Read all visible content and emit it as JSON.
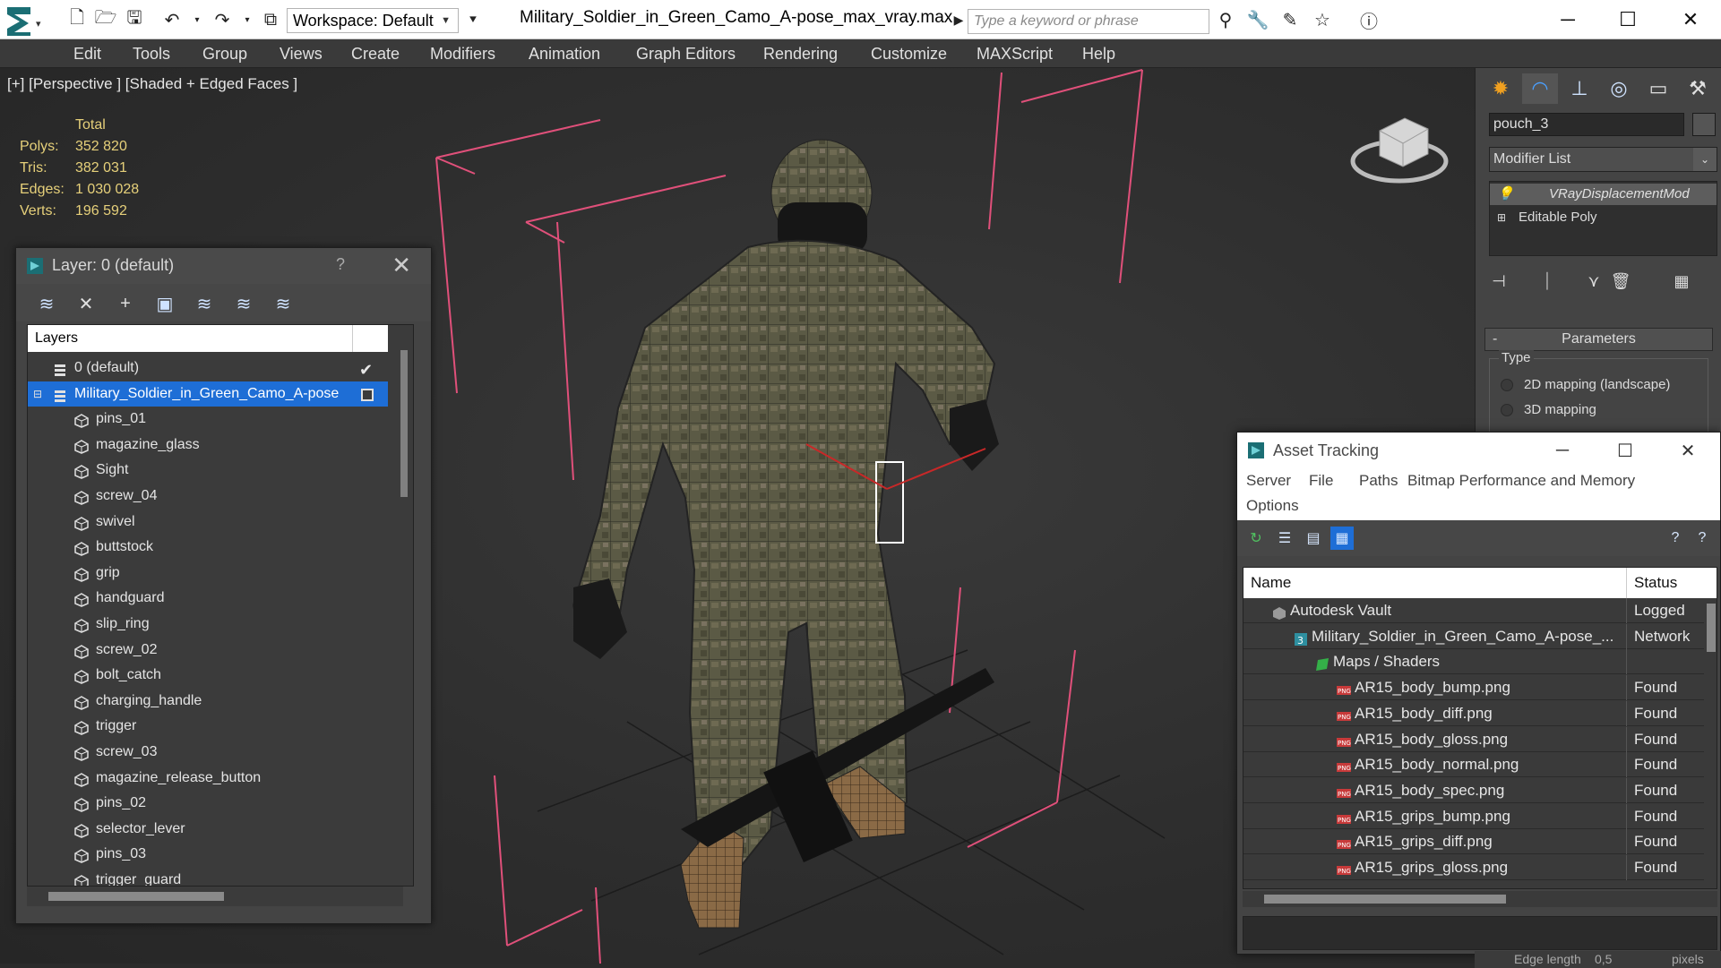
{
  "titlebar": {
    "workspace": "Workspace: Default",
    "file_title": "Military_Soldier_in_Green_Camo_A-pose_max_vray.max",
    "search_placeholder": "Type a keyword or phrase"
  },
  "menu": [
    "Edit",
    "Tools",
    "Group",
    "Views",
    "Create",
    "Modifiers",
    "Animation",
    "Graph Editors",
    "Rendering",
    "Customize",
    "MAXScript",
    "Help"
  ],
  "viewport": {
    "label": "[+] [Perspective ] [Shaded + Edged Faces ]",
    "stats": {
      "header": "Total",
      "rows": [
        {
          "k": "Polys:",
          "v": "352 820"
        },
        {
          "k": "Tris:",
          "v": "382 031"
        },
        {
          "k": "Edges:",
          "v": "1 030 028"
        },
        {
          "k": "Verts:",
          "v": "196 592"
        }
      ]
    }
  },
  "layer_dialog": {
    "title": "Layer: 0 (default)",
    "help": "?",
    "list_header": "Layers",
    "rows": [
      {
        "label": "0 (default)",
        "kind": "layer"
      },
      {
        "label": "Military_Soldier_in_Green_Camo_A-pose",
        "kind": "layer-selected"
      },
      {
        "label": "pins_01",
        "kind": "object"
      },
      {
        "label": "magazine_glass",
        "kind": "object"
      },
      {
        "label": "Sight",
        "kind": "object"
      },
      {
        "label": "screw_04",
        "kind": "object"
      },
      {
        "label": "swivel",
        "kind": "object"
      },
      {
        "label": "buttstock",
        "kind": "object"
      },
      {
        "label": "grip",
        "kind": "object"
      },
      {
        "label": "handguard",
        "kind": "object"
      },
      {
        "label": "slip_ring",
        "kind": "object"
      },
      {
        "label": "screw_02",
        "kind": "object"
      },
      {
        "label": "bolt_catch",
        "kind": "object"
      },
      {
        "label": "charging_handle",
        "kind": "object"
      },
      {
        "label": "trigger",
        "kind": "object"
      },
      {
        "label": "screw_03",
        "kind": "object"
      },
      {
        "label": "magazine_release_button",
        "kind": "object"
      },
      {
        "label": "pins_02",
        "kind": "object"
      },
      {
        "label": "selector_lever",
        "kind": "object"
      },
      {
        "label": "pins_03",
        "kind": "object"
      },
      {
        "label": "trigger_guard",
        "kind": "object"
      }
    ]
  },
  "command_panel": {
    "object_name": "pouch_3",
    "modifier_list": "Modifier List",
    "stack": [
      "VRayDisplacementMod",
      "Editable Poly"
    ],
    "params_title": "Parameters",
    "type_label": "Type",
    "options": [
      "2D mapping (landscape)",
      "3D mapping"
    ]
  },
  "asset_tracking": {
    "title": "Asset Tracking",
    "menu": [
      "Server",
      "File",
      "Paths",
      "Bitmap Performance and Memory",
      "Options"
    ],
    "columns": {
      "name": "Name",
      "status": "Status"
    },
    "rows": [
      {
        "name": "Autodesk Vault",
        "status": "Logged",
        "indent": 1,
        "icon": "vault"
      },
      {
        "name": "Military_Soldier_in_Green_Camo_A-pose_...",
        "status": "Network",
        "indent": 2,
        "icon": "max-file"
      },
      {
        "name": "Maps / Shaders",
        "status": "",
        "indent": 3,
        "icon": "maps"
      },
      {
        "name": "AR15_body_bump.png",
        "status": "Found",
        "indent": 4,
        "icon": "png"
      },
      {
        "name": "AR15_body_diff.png",
        "status": "Found",
        "indent": 4,
        "icon": "png"
      },
      {
        "name": "AR15_body_gloss.png",
        "status": "Found",
        "indent": 4,
        "icon": "png"
      },
      {
        "name": "AR15_body_normal.png",
        "status": "Found",
        "indent": 4,
        "icon": "png"
      },
      {
        "name": "AR15_body_spec.png",
        "status": "Found",
        "indent": 4,
        "icon": "png"
      },
      {
        "name": "AR15_grips_bump.png",
        "status": "Found",
        "indent": 4,
        "icon": "png"
      },
      {
        "name": "AR15_grips_diff.png",
        "status": "Found",
        "indent": 4,
        "icon": "png"
      },
      {
        "name": "AR15_grips_gloss.png",
        "status": "Found",
        "indent": 4,
        "icon": "png"
      }
    ]
  },
  "status_strip": {
    "label": "Edge length",
    "value": "0,5",
    "unit": "pixels"
  },
  "colors": {
    "selection": "#1e6ed6",
    "stats": "#e6d07a",
    "bbox": "#e0507a"
  }
}
